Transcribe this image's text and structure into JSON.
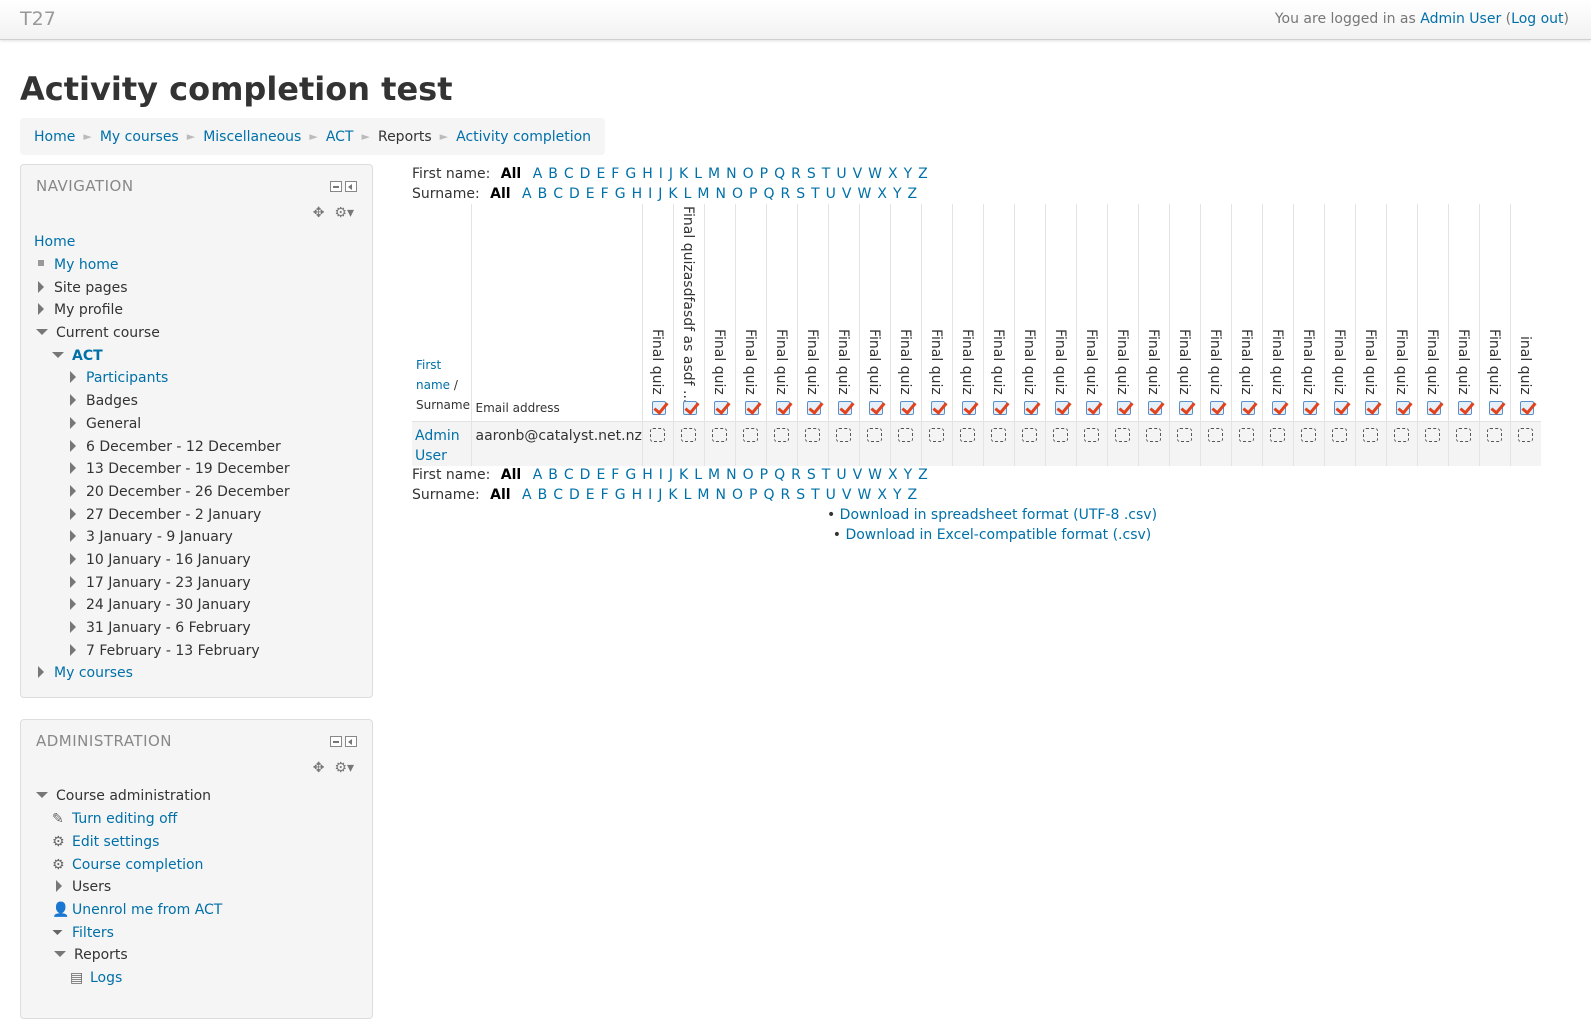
{
  "header": {
    "brand": "T27",
    "logged_in_prefix": "You are logged in as",
    "user_name": "Admin User",
    "logout": "Log out"
  },
  "page_title": "Activity completion test",
  "breadcrumb": [
    "Home",
    "My courses",
    "Miscellaneous",
    "ACT",
    "Reports",
    "Activity completion"
  ],
  "navigation": {
    "title": "NAVIGATION",
    "home": "Home",
    "my_home": "My home",
    "site_pages": "Site pages",
    "my_profile": "My profile",
    "current_course": "Current course",
    "course": "ACT",
    "participants": "Participants",
    "badges": "Badges",
    "general": "General",
    "weeks": [
      "6 December - 12 December",
      "13 December - 19 December",
      "20 December - 26 December",
      "27 December - 2 January",
      "3 January - 9 January",
      "10 January - 16 January",
      "17 January - 23 January",
      "24 January - 30 January",
      "31 January - 6 February",
      "7 February - 13 February"
    ],
    "my_courses": "My courses"
  },
  "administration": {
    "title": "ADMINISTRATION",
    "course_admin": "Course administration",
    "turn_editing_off": "Turn editing off",
    "edit_settings": "Edit settings",
    "course_completion": "Course completion",
    "users": "Users",
    "unenrol": "Unenrol me from ACT",
    "filters": "Filters",
    "reports": "Reports",
    "logs": "Logs"
  },
  "filters": {
    "first_name_label": "First name:",
    "surname_label": "Surname:",
    "all": "All",
    "letters": [
      "A",
      "B",
      "C",
      "D",
      "E",
      "F",
      "G",
      "H",
      "I",
      "J",
      "K",
      "L",
      "M",
      "N",
      "O",
      "P",
      "Q",
      "R",
      "S",
      "T",
      "U",
      "V",
      "W",
      "X",
      "Y",
      "Z"
    ]
  },
  "table": {
    "col_first_name": "First name",
    "col_separator": "/",
    "col_surname": "Surname",
    "col_email": "Email address",
    "activities": [
      "Final quiz",
      "Final quizasdfasdf as asdf ...",
      "Final quiz",
      "Final quiz",
      "Final quiz",
      "Final quiz",
      "Final quiz",
      "Final quiz",
      "Final quiz",
      "Final quiz",
      "Final quiz",
      "Final quiz",
      "Final quiz",
      "Final quiz",
      "Final quiz",
      "Final quiz",
      "Final quiz",
      "Final quiz",
      "Final quiz",
      "Final quiz",
      "Final quiz",
      "Final quiz",
      "Final quiz",
      "Final quiz",
      "Final quiz",
      "Final quiz",
      "Final quiz",
      "Final quiz",
      "inal quiz"
    ],
    "rows": [
      {
        "name": "Admin User",
        "email": "aaronb@catalyst.net.nz"
      }
    ]
  },
  "downloads": [
    "Download in spreadsheet format (UTF-8 .csv)",
    "Download in Excel-compatible format (.csv)"
  ]
}
